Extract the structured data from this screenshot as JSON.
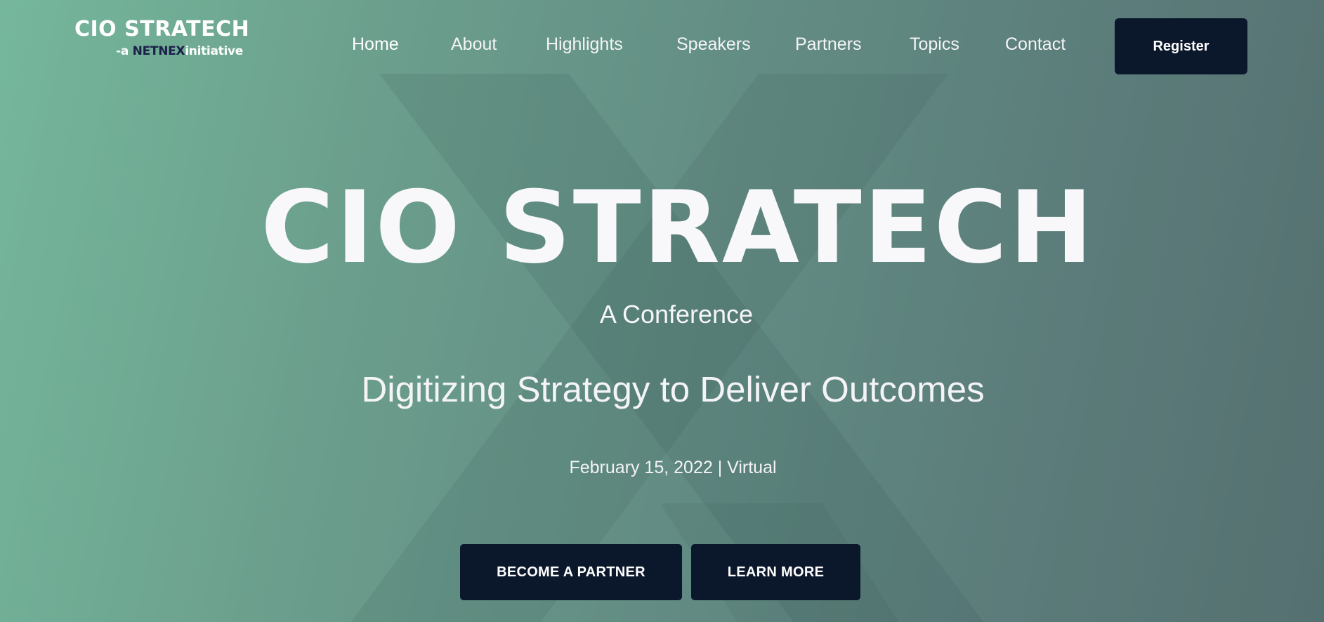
{
  "header": {
    "logo": {
      "title": "CIO STRATECH",
      "sub_prefix": "-a ",
      "sub_brand": "NETNEX",
      "sub_suffix": "initiative"
    },
    "nav": {
      "items": [
        {
          "label": "Home",
          "active": true
        },
        {
          "label": "About"
        },
        {
          "label": "Highlights"
        },
        {
          "label": "Speakers"
        },
        {
          "label": "Partners"
        },
        {
          "label": "Topics"
        },
        {
          "label": "Contact"
        }
      ]
    },
    "register_label": "Register"
  },
  "hero": {
    "title": "CIO STRATECH",
    "subtitle": "A Conference",
    "tagline": "Digitizing Strategy to Deliver Outcomes",
    "date_line": "February 15, 2022 | Virtual",
    "buttons": {
      "partner_label": "BECOME A PARTNER",
      "learn_label": "LEARN MORE"
    },
    "watermark_icon": "x-mark-icon"
  },
  "colors": {
    "dark_navy": "#0b182b",
    "text_white": "#f8f7fa",
    "brand_dark": "#1b1f4a",
    "gradient_start": "#75b79c",
    "gradient_end": "#557070"
  }
}
